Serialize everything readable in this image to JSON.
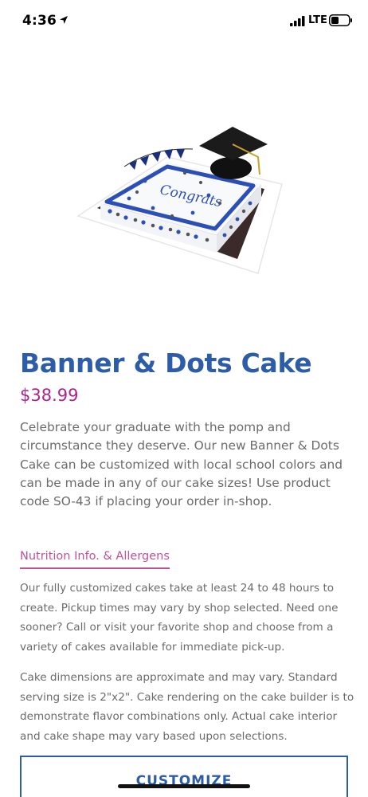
{
  "status_bar": {
    "time": "4:36",
    "network": "LTE"
  },
  "product": {
    "image_icon": "graduation-cake-illustration",
    "image_text": "Congrats",
    "title": "Banner & Dots Cake",
    "price": "$38.99",
    "description": "Celebrate your graduate with the pomp and circumstance they deserve. Our new Banner & Dots Cake can be customized with local school colors and can be made in any of our cake sizes! Use product code SO-43 if placing your order in-shop.",
    "nutrition_link": "Nutrition Info. & Allergens",
    "info_paragraphs": [
      "Our fully customized cakes take at least 24 to 48 hours to create. Pickup times may vary by shop selected. Need one sooner? Call or visit your favorite shop and choose from a variety of cakes available for immediate pick-up.",
      "Cake dimensions are approximate and may vary. Standard serving size is 2\"x2\". Cake rendering on the cake builder is to demonstrate flavor combinations only. Actual cake interior and cake shape may vary based upon selections."
    ],
    "customize_label": "CUSTOMIZE"
  },
  "colors": {
    "title_blue": "#2d5da8",
    "price_magenta": "#b0238a",
    "link_pink": "#c0529a",
    "body_gray": "#6b6b6b"
  }
}
